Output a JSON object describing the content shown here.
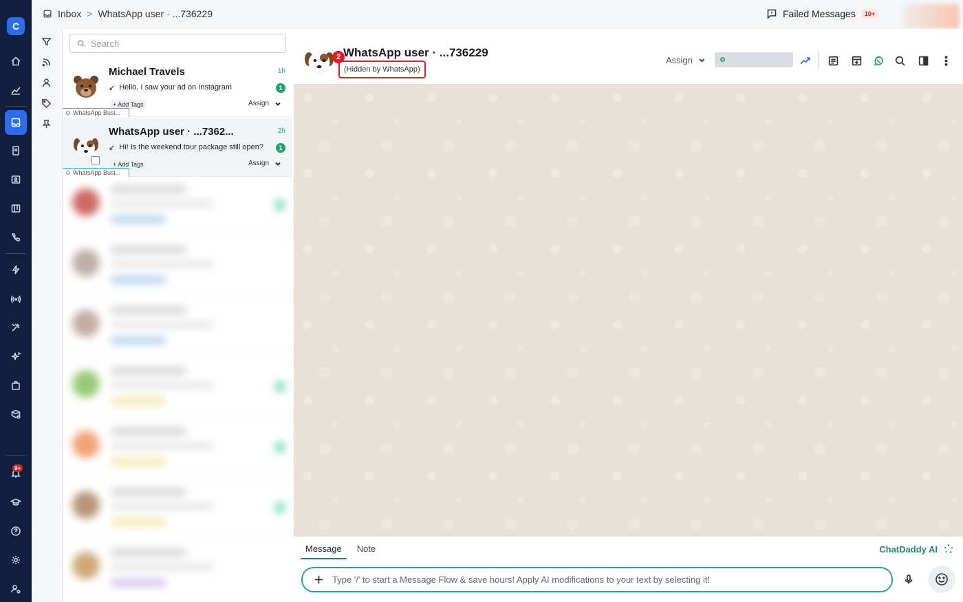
{
  "breadcrumb": {
    "root": "Inbox",
    "separator": ">",
    "current": "WhatsApp user · ...736229"
  },
  "header": {
    "failed_label": "Failed Messages",
    "failed_count": "10+"
  },
  "rail": {
    "logo": "C",
    "notification_badge": "9+"
  },
  "search": {
    "placeholder": "Search"
  },
  "conversations": [
    {
      "name": "Michael Travels",
      "time": "1h",
      "message": "Hello, I saw your ad on Instagram",
      "unread": "1",
      "tags_label": "+ Add Tags",
      "assign_label": "Assign",
      "channel": "WhatsApp Busi..."
    },
    {
      "name": "WhatsApp user · ...7362...",
      "time": "2h",
      "message": "Hi! Is the weekend tour package still open?",
      "unread": "1",
      "tags_label": "+ Add Tags",
      "assign_label": "Assign",
      "channel": "WhatsApp Busi..."
    }
  ],
  "chat": {
    "step_number": "2",
    "title": "WhatsApp user · ...736229",
    "subtitle": "(Hidden by WhatsApp)",
    "assign_label": "Assign"
  },
  "composer": {
    "tabs": [
      "Message",
      "Note"
    ],
    "ai_label": "ChatDaddy AI",
    "placeholder": "Type '/' to start a Message Flow & save hours! Apply AI modifications to your text by selecting it!"
  },
  "colors": {
    "accent": "#2b6cf0",
    "whatsapp_green": "#2aa876",
    "alert_red": "#e11d2a"
  }
}
